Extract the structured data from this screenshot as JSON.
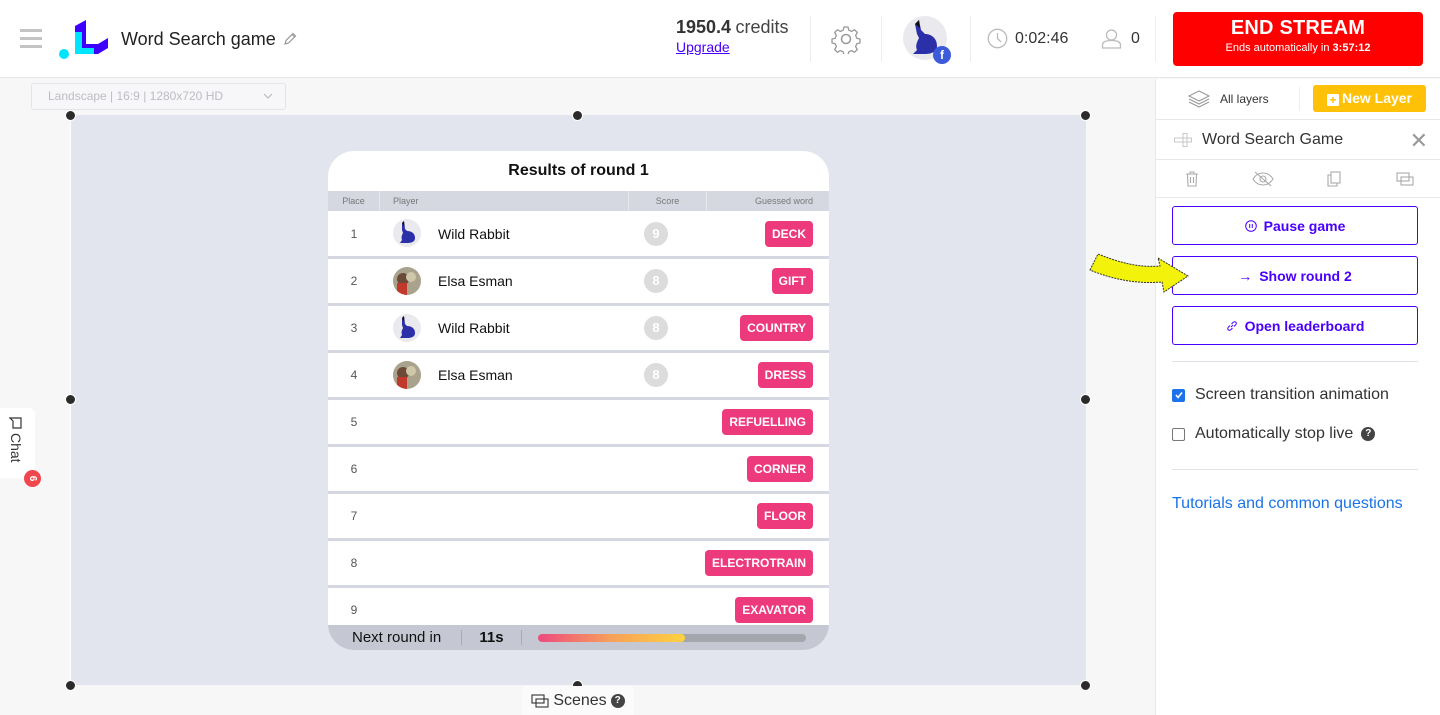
{
  "header": {
    "app_title": "Word Search game",
    "credits_value": "1950.4",
    "credits_unit": "credits",
    "upgrade_label": "Upgrade",
    "elapsed_time": "0:02:46",
    "viewer_count": "0",
    "avatar_badge": "f",
    "end_stream": {
      "label": "END STREAM",
      "sub_prefix": "Ends automatically in",
      "sub_time": "3:57:12",
      "color": "#ff0000"
    }
  },
  "stage": {
    "resolution_select": "Landscape | 16:9 | 1280x720 HD",
    "chat_label": "Chat",
    "chat_badge": "6",
    "scenes_label": "Scenes",
    "help_mark": "?"
  },
  "results": {
    "title": "Results of round 1",
    "columns": [
      "Place",
      "Player",
      "Score",
      "Guessed word"
    ],
    "rows": [
      {
        "place": "1",
        "player": "Wild Rabbit",
        "avatar": "rabbit",
        "score": "9",
        "word": "DECK"
      },
      {
        "place": "2",
        "player": "Elsa Esman",
        "avatar": "photo",
        "score": "8",
        "word": "GIFT"
      },
      {
        "place": "3",
        "player": "Wild Rabbit",
        "avatar": "rabbit",
        "score": "8",
        "word": "COUNTRY"
      },
      {
        "place": "4",
        "player": "Elsa Esman",
        "avatar": "photo",
        "score": "8",
        "word": "DRESS"
      },
      {
        "place": "5",
        "player": "",
        "avatar": "",
        "score": "",
        "word": "REFUELLING"
      },
      {
        "place": "6",
        "player": "",
        "avatar": "",
        "score": "",
        "word": "CORNER"
      },
      {
        "place": "7",
        "player": "",
        "avatar": "",
        "score": "",
        "word": "FLOOR"
      },
      {
        "place": "8",
        "player": "",
        "avatar": "",
        "score": "",
        "word": "ELECTROTRAIN"
      },
      {
        "place": "9",
        "player": "",
        "avatar": "",
        "score": "",
        "word": "EXAVATOR"
      }
    ],
    "footer": {
      "label": "Next round in",
      "seconds": "11s",
      "progress_percent": 55
    },
    "word_badge_color": "#ec3a7d"
  },
  "panel": {
    "all_layers_label": "All layers",
    "new_layer_label": "New Layer",
    "layer_title": "Word Search Game",
    "tools": [
      "trash-icon",
      "eye-off-icon",
      "copy-icon",
      "scenes-icon"
    ],
    "buttons": {
      "pause": "Pause game",
      "show_round": "Show round 2",
      "leaderboard": "Open leaderboard"
    },
    "options": [
      {
        "label": "Screen transition animation",
        "checked": true
      },
      {
        "label": "Automatically stop live",
        "checked": false,
        "help": true
      }
    ],
    "tutorials_link": "Tutorials and common questions",
    "accent_color": "#4a00ff",
    "new_layer_color": "#ffc107"
  }
}
